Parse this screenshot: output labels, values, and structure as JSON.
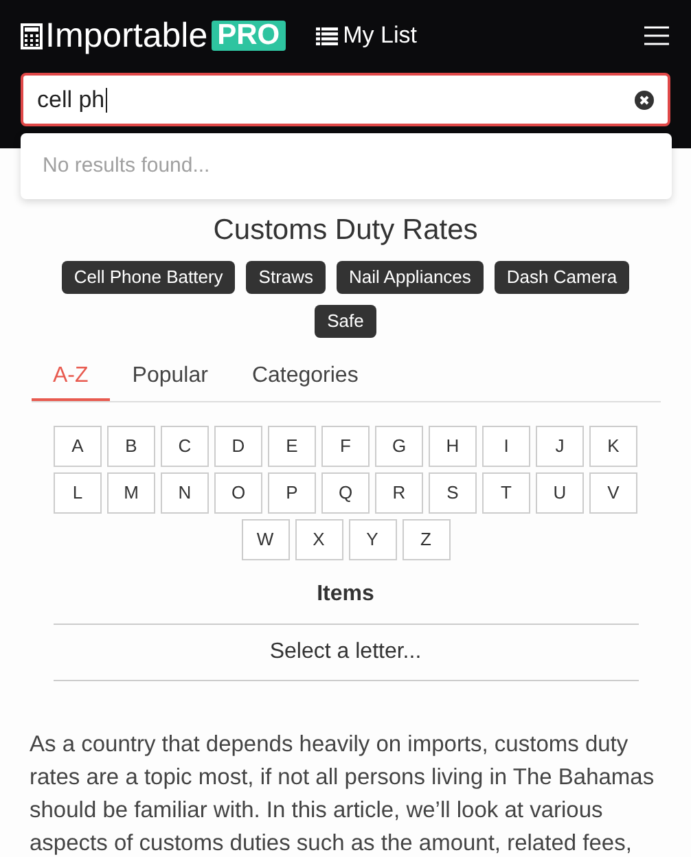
{
  "header": {
    "logo": "Importable",
    "badge": "PRO",
    "nav_link": "My List"
  },
  "search": {
    "value": "cell ph",
    "dropdown_message": "No results found..."
  },
  "title": {
    "heading": "Customs Duty Rates"
  },
  "tags": [
    "Cell Phone Battery",
    "Straws",
    "Nail Appliances",
    "Dash Camera",
    "Safe"
  ],
  "tabs": [
    {
      "label": "A-Z",
      "selected": true
    },
    {
      "label": "Popular",
      "selected": false
    },
    {
      "label": "Categories",
      "selected": false
    }
  ],
  "letters": [
    [
      "A",
      "B",
      "C",
      "D",
      "E",
      "F",
      "G",
      "H",
      "I",
      "J",
      "K"
    ],
    [
      "L",
      "M",
      "N",
      "O",
      "P",
      "Q",
      "R",
      "S",
      "T",
      "U",
      "V"
    ],
    [
      "W",
      "X",
      "Y",
      "Z"
    ]
  ],
  "items": {
    "heading": "Items",
    "placeholder": "Select a letter..."
  },
  "paragraph": "As a country that depends heavily on imports, customs duty rates are a topic most, if not all persons living in The Bahamas should be familiar with. In this article, we’ll look at various aspects of customs duties such as the amount, related fees,"
}
